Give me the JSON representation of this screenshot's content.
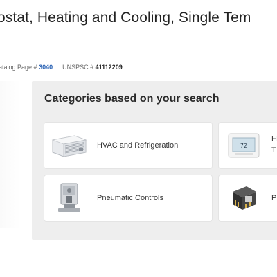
{
  "product": {
    "title": "ostat, Heating and Cooling, Single Tem",
    "catalog_page_label": "atalog Page #",
    "catalog_page_value": "3040",
    "unspsc_label": "UNSPSC #",
    "unspsc_value": "41112209"
  },
  "categories": {
    "heading": "Categories based on your search",
    "items": [
      {
        "label": "HVAC and Refrigeration",
        "icon": "air-conditioner-icon"
      },
      {
        "label_top": "H",
        "label_bottom": "T",
        "icon": "thermostat-icon"
      },
      {
        "label": "Pneumatic Controls",
        "icon": "pressure-switch-icon"
      },
      {
        "label": "P",
        "icon": "relay-icon"
      }
    ]
  },
  "colors": {
    "link_blue": "#2b63b5",
    "panel_bg": "#eeeeee",
    "card_bg": "#ffffff"
  }
}
